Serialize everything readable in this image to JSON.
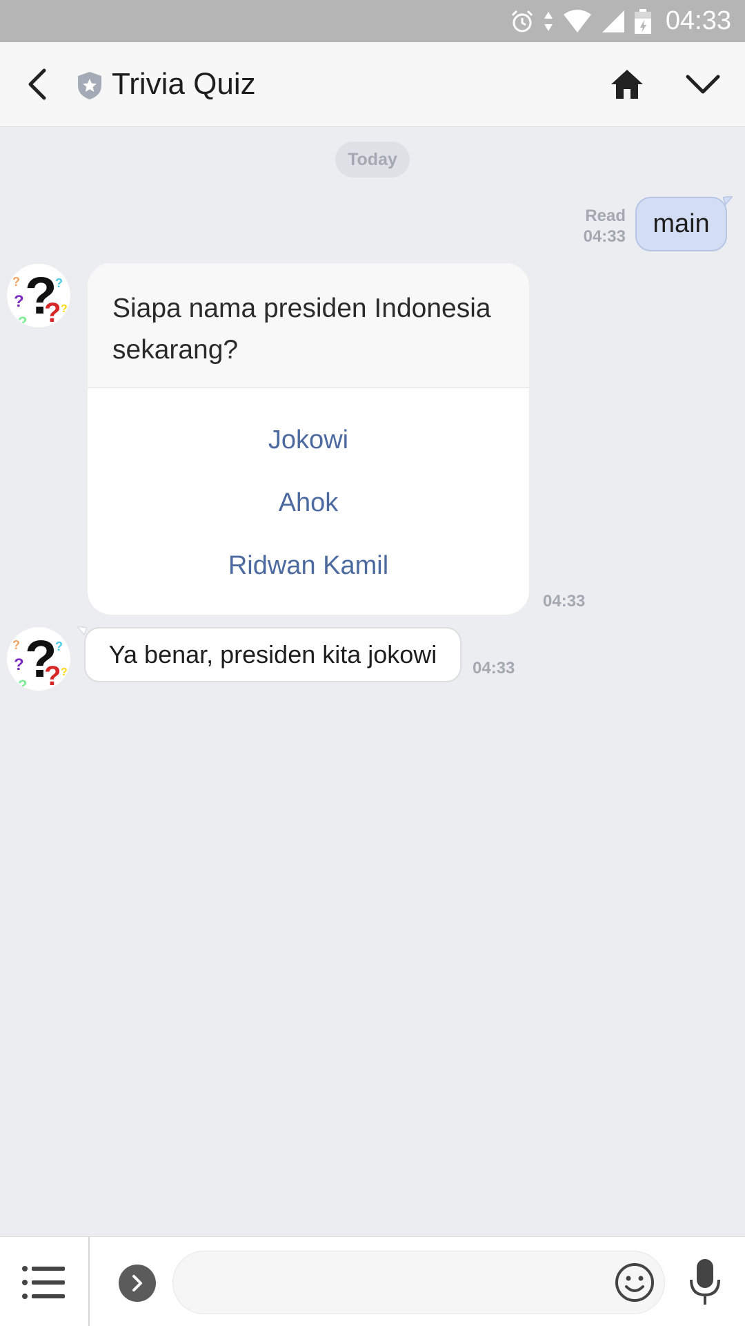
{
  "status_bar": {
    "time": "04:33",
    "icons": [
      "alarm-icon",
      "data-transfer-icon",
      "wifi-icon",
      "signal-icon",
      "battery-icon"
    ]
  },
  "header": {
    "title": "Trivia Quiz",
    "icons": [
      "back-arrow-icon",
      "official-shield-icon",
      "home-icon",
      "chevron-down-icon"
    ]
  },
  "chat": {
    "date_label": "Today",
    "outgoing": {
      "text": "main",
      "read_label": "Read",
      "time": "04:33"
    },
    "quiz": {
      "question": "Siapa nama presiden Indonesia sekarang?",
      "options": [
        "Jokowi",
        "Ahok",
        "Ridwan Kamil"
      ],
      "time": "04:33"
    },
    "reply": {
      "text": "Ya benar, presiden kita jokowi",
      "time": "04:33"
    }
  },
  "bottom_bar": {
    "input_value": "",
    "icons": [
      "menu-list-icon",
      "expand-chevron-icon",
      "emoji-icon",
      "microphone-icon"
    ]
  },
  "colors": {
    "background": "#ecedf1",
    "outgoing_bubble": "#d3ddf3",
    "option_link": "#4c6aa0",
    "status_bar": "#b5b5b5"
  }
}
